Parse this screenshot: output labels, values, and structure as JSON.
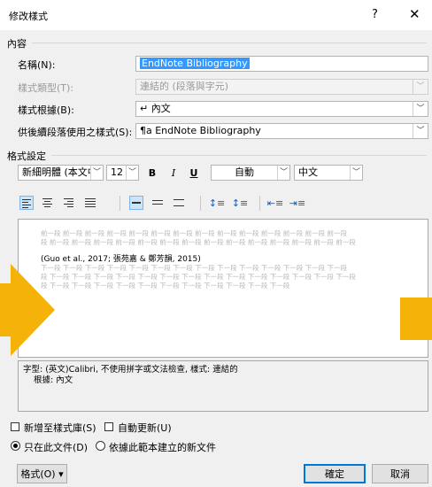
{
  "dialog": {
    "title": "修改樣式",
    "help": "?",
    "close": "✕"
  },
  "properties": {
    "section": "內容",
    "name_label": "名稱(N):",
    "name_value": "EndNote Bibliography",
    "type_label": "樣式類型(T):",
    "type_value": "連結的 (段落與字元)",
    "base_label": "樣式根據(B):",
    "base_value": "↵ 內文",
    "next_label": "供後續段落使用之樣式(S):",
    "next_value": "¶a EndNote Bibliography"
  },
  "formatting": {
    "section": "格式設定",
    "font": "新細明體 (本文中",
    "size": "12",
    "bold": "B",
    "italic": "I",
    "underline": "U",
    "color": "自動",
    "language": "中文"
  },
  "preview": {
    "prev_line1": "前一段 前一段 前一段 前一段 前一段 前一段 前一段 前一段 前一段 前一段 前一段 前一段 前一段 前一段",
    "prev_line2": "段 前一段 前一段 前一段 前一段 前一段 前一段 前一段 前一段 前一段 前一段 前一段 前一段 前一段 前一段",
    "sample": "(Guo et al., 2017; 張苑嘉 & 鄭芳韻, 2015)",
    "next_line1": "下一段 下一段 下一段 下一段 下一段 下一段 下一段 下一段 下一段 下一段 下一段 下一段 下一段 下一段",
    "next_line2": "段 下一段 下一段 下一段 下一段 下一段 下一段 下一段 下一段 下一段 下一段 下一段 下一段 下一段 下一段",
    "next_line3": "段 下一段 下一段 下一段 下一段 下一段 下一段 下一段 下一段 下一段 下一段 下一段"
  },
  "description": {
    "line1": "字型: (英文)Calibri, 不使用拼字或文法檢查, 樣式: 連結的",
    "line2": "根據: 內文"
  },
  "options": {
    "add_gallery": "新增至樣式庫(S)",
    "auto_update": "自動更新(U)",
    "only_doc": "只在此文件(D)",
    "new_docs": "依據此範本建立的新文件"
  },
  "buttons": {
    "format": "格式(O) ▾",
    "ok": "確定",
    "cancel": "取消"
  },
  "colors": {
    "accent": "#0078d7",
    "highlight": "#3399ff",
    "overlay": "#f5b30a"
  }
}
